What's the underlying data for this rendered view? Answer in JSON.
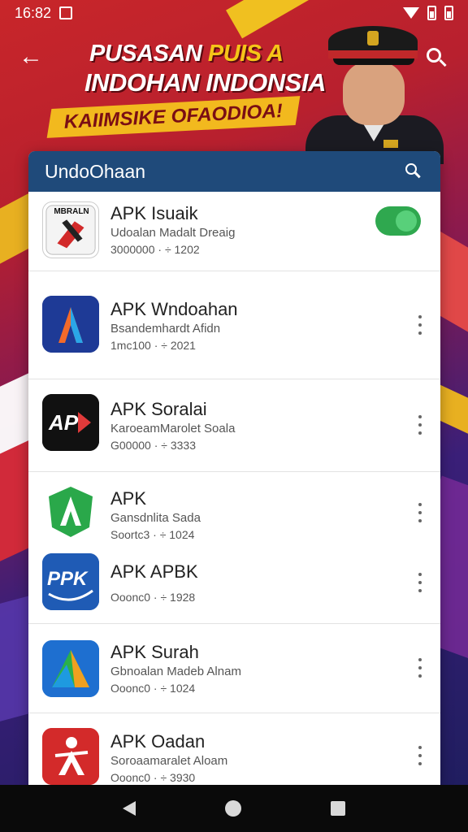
{
  "status_bar": {
    "time": "16:82"
  },
  "banner": {
    "line1_a": "PUSASAN ",
    "line1_b": "PUIS A",
    "line2": "INDOHAN INDONSIA",
    "ribbon": "KAIIMSIKE OFAODIOA!"
  },
  "panel": {
    "title": "UndoOhaan"
  },
  "apps": [
    {
      "name": "APK Isuaik",
      "subtitle": "Udoalan Madalt Dreaig",
      "meta": "3000000 · ÷ 1202",
      "icon": "photo-thumbnail-icon",
      "icon_text": "MBRALN",
      "control": "toggle",
      "toggle_on": true
    },
    {
      "name": "APK Wndoahan",
      "subtitle": "Bsandemhardt Afidn",
      "meta": "1mc100 · ÷ 2021",
      "icon": "letter-a-icon",
      "icon_text": "A",
      "control": "more"
    },
    {
      "name": "APK Soralai",
      "subtitle": "KaroeamMarolet Soala",
      "meta": "G00000 · ÷ 3333",
      "icon": "ap-logo-icon",
      "icon_text": "AP",
      "control": "more"
    },
    {
      "name": "APK",
      "subtitle": "Gansdnlita Sada",
      "meta": "Soortc3 · ÷ 1024",
      "icon": "green-a-icon",
      "icon_text": "A",
      "control": "more"
    },
    {
      "name": "APK APBK",
      "subtitle": "",
      "meta": "Ooonc0 · ÷ 1928",
      "icon": "ppk-logo-icon",
      "icon_text": "PPK",
      "control": "more"
    },
    {
      "name": "APK Surah",
      "subtitle": "Gbnoalan Madeb Alnam",
      "meta": "Ooonc0 · ÷ 1024",
      "icon": "triangle-a-icon",
      "icon_text": "",
      "control": "more"
    },
    {
      "name": "APK Oadan",
      "subtitle": "Soroaamaralet Aloam",
      "meta": "Ooonc0 · ÷ 3930",
      "icon": "red-figure-icon",
      "icon_text": "",
      "control": "more"
    }
  ],
  "colors": {
    "panel_header": "#1f4a7a",
    "toggle_on": "#2fa84f",
    "banner_accent": "#f5c518"
  }
}
